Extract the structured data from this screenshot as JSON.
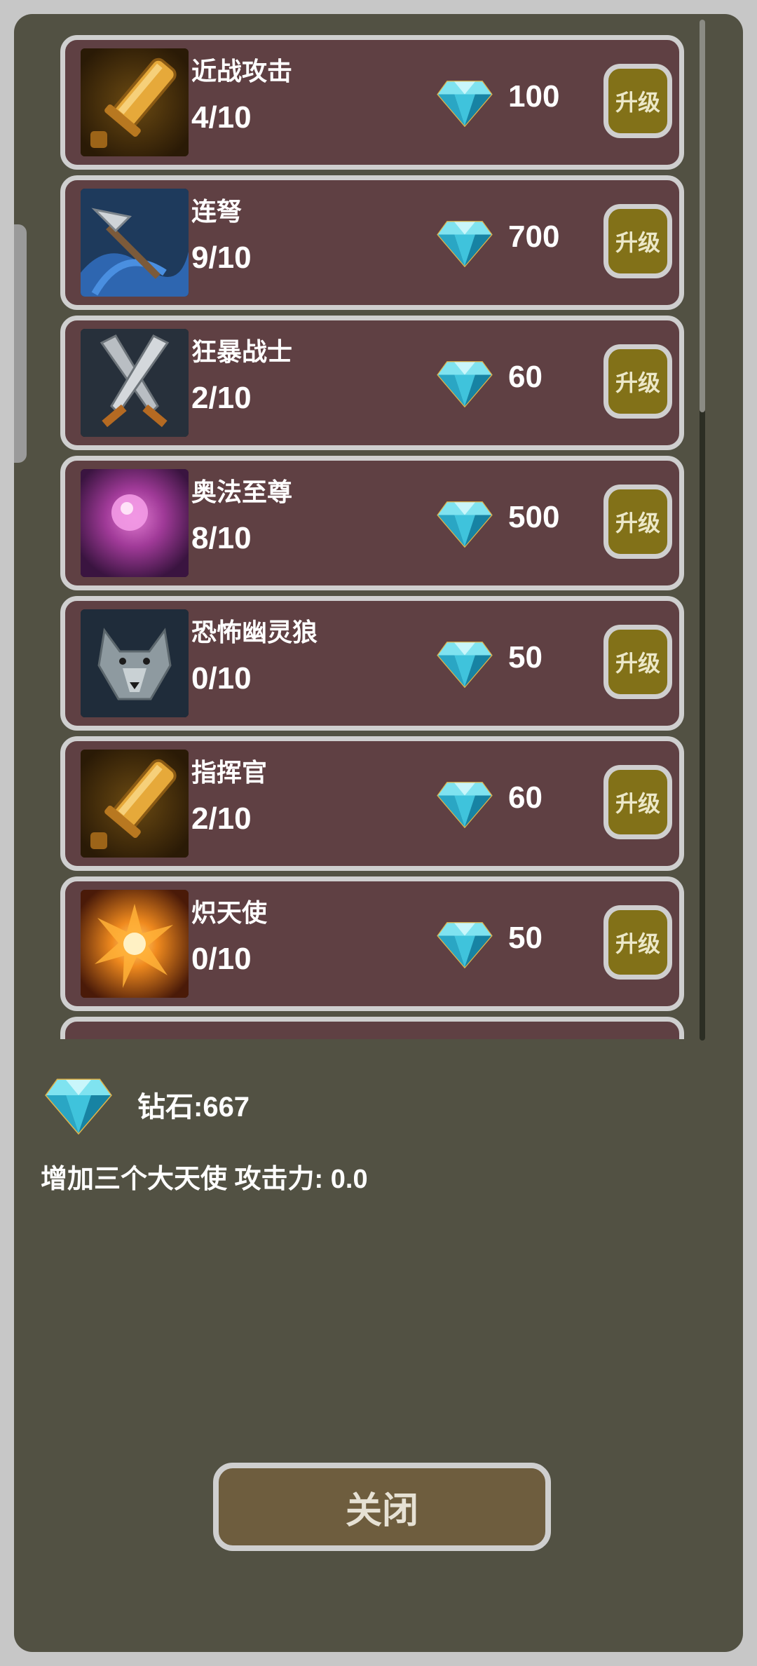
{
  "skills": [
    {
      "name": "近战攻击",
      "level": "4/10",
      "cost": "100",
      "upgrade_label": "升级",
      "icon": "sword-icon"
    },
    {
      "name": "连弩",
      "level": "9/10",
      "cost": "700",
      "upgrade_label": "升级",
      "icon": "crossbow-bolt-icon"
    },
    {
      "name": "狂暴战士",
      "level": "2/10",
      "cost": "60",
      "upgrade_label": "升级",
      "icon": "crossed-swords-icon"
    },
    {
      "name": "奥法至尊",
      "level": "8/10",
      "cost": "500",
      "upgrade_label": "升级",
      "icon": "arcane-orb-icon"
    },
    {
      "name": "恐怖幽灵狼",
      "level": "0/10",
      "cost": "50",
      "upgrade_label": "升级",
      "icon": "wolf-icon"
    },
    {
      "name": "指挥官",
      "level": "2/10",
      "cost": "60",
      "upgrade_label": "升级",
      "icon": "sword-icon"
    },
    {
      "name": "炽天使",
      "level": "0/10",
      "cost": "50",
      "upgrade_label": "升级",
      "icon": "fire-burst-icon"
    }
  ],
  "balance": {
    "label": "钻石:667",
    "icon": "diamond-icon"
  },
  "description": "增加三个大天使 攻击力: 0.0",
  "close_label": "关闭",
  "colors": {
    "panel": "#525143",
    "card": "#5f4043",
    "border": "#cfcfcf",
    "upgrade_button": "#827118",
    "close_button": "#6e5d3e"
  }
}
